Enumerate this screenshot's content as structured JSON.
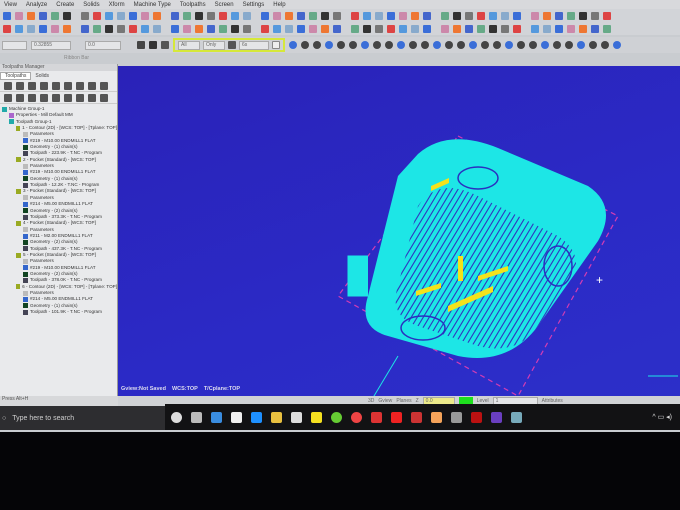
{
  "menu": [
    "View",
    "Analyze",
    "Create",
    "Solids",
    "Xform",
    "Machine Type",
    "Toolpaths",
    "Screen",
    "Settings",
    "Help"
  ],
  "ribbon": {
    "label": "Ribbon Bar",
    "field1": "0.32855",
    "field2": "0.0",
    "all": "All",
    "only": "Only",
    "mode": "6s"
  },
  "panel": {
    "title": "Toolpaths Manager",
    "tabs": [
      "Toolpaths",
      "Solids"
    ]
  },
  "tree": [
    {
      "lvl": 0,
      "t": "Machine Group-1",
      "k": "group"
    },
    {
      "lvl": 1,
      "t": "Properties - Mill Default MM",
      "k": "prop"
    },
    {
      "lvl": 1,
      "t": "Toolpath Group-1",
      "k": "group"
    },
    {
      "lvl": 2,
      "t": "1 - Contour (2D) - [WCS: TOP] - [Tplane: TOP]",
      "k": "op"
    },
    {
      "lvl": 3,
      "t": "Parameters",
      "k": "param"
    },
    {
      "lvl": 3,
      "t": "#219 - M10.00 ENDMILL1 FLAT",
      "k": "tool"
    },
    {
      "lvl": 3,
      "t": "Geometry - (1) chain(s)",
      "k": "geo"
    },
    {
      "lvl": 3,
      "t": "Toolpath - 223.9K - T.NC - Program",
      "k": "path"
    },
    {
      "lvl": 2,
      "t": "2 - Pocket (Standard) - [WCS: TOP]",
      "k": "op"
    },
    {
      "lvl": 3,
      "t": "Parameters",
      "k": "param"
    },
    {
      "lvl": 3,
      "t": "#219 - M10.00 ENDMILL1 FLAT",
      "k": "tool"
    },
    {
      "lvl": 3,
      "t": "Geometry - (1) chain(s)",
      "k": "geo"
    },
    {
      "lvl": 3,
      "t": "Toolpath - 12.2K - T.NC - Program",
      "k": "path"
    },
    {
      "lvl": 2,
      "t": "3 - Pocket (Standard) - [WCS: TOP]",
      "k": "op"
    },
    {
      "lvl": 3,
      "t": "Parameters",
      "k": "param"
    },
    {
      "lvl": 3,
      "t": "#214 - M5.00 ENDMILL1 FLAT",
      "k": "tool"
    },
    {
      "lvl": 3,
      "t": "Geometry - (2) chain(s)",
      "k": "geo"
    },
    {
      "lvl": 3,
      "t": "Toolpath - 373.3K - T.NC - Program",
      "k": "path"
    },
    {
      "lvl": 2,
      "t": "4 - Pocket (Standard) - [WCS: TOP]",
      "k": "op"
    },
    {
      "lvl": 3,
      "t": "Parameters",
      "k": "param"
    },
    {
      "lvl": 3,
      "t": "#211 - M2.00 ENDMILL1 FLAT",
      "k": "tool"
    },
    {
      "lvl": 3,
      "t": "Geometry - (2) chain(s)",
      "k": "geo"
    },
    {
      "lvl": 3,
      "t": "Toolpath - 437.3K - T.NC - Program",
      "k": "path"
    },
    {
      "lvl": 2,
      "t": "5 - Pocket (Standard) - [WCS: TOP]",
      "k": "op"
    },
    {
      "lvl": 3,
      "t": "Parameters",
      "k": "param"
    },
    {
      "lvl": 3,
      "t": "#219 - M10.00 ENDMILL1 FLAT",
      "k": "tool"
    },
    {
      "lvl": 3,
      "t": "Geometry - (2) chain(s)",
      "k": "geo"
    },
    {
      "lvl": 3,
      "t": "Toolpath - 378.0K - T.NC - Program",
      "k": "path"
    },
    {
      "lvl": 2,
      "t": "6 - Contour (2D) - [WCS: TOP] - [Tplane: TOP]",
      "k": "op"
    },
    {
      "lvl": 3,
      "t": "Parameters",
      "k": "param"
    },
    {
      "lvl": 3,
      "t": "#214 - M5.00 ENDMILL1 FLAT",
      "k": "tool"
    },
    {
      "lvl": 3,
      "t": "Geometry - (1) chain(s)",
      "k": "geo"
    },
    {
      "lvl": 3,
      "t": "Toolpath - 101.9K - T.NC - Program",
      "k": "path"
    }
  ],
  "viewport": {
    "gview": "Gview:Not Saved",
    "wcs": "WCS:TOP",
    "tplane": "T/Cplane:TOP"
  },
  "statusbar": {
    "mode": "3D",
    "gview": "Gview",
    "planes": "Planes",
    "z_label": "Z",
    "z": "0.0",
    "level_label": "Level",
    "level": "1",
    "attributes": "Attributes"
  },
  "leftstub": "Press Alt+H",
  "search": {
    "placeholder": "Type here to search"
  },
  "taskbar": {
    "apps": [
      "cortana",
      "task-view",
      "people",
      "store",
      "edge",
      "file-explorer",
      "mail",
      "sticky-notes",
      "utorrent",
      "chrome",
      "app-red",
      "acrobat",
      "app-red2",
      "app-orange",
      "mastercam",
      "app-dark",
      "app-purple",
      "app-network"
    ]
  },
  "colors": {
    "viewport": "#2b28c2",
    "part": "#1de6e6",
    "feature": "#f4e21c",
    "boundary": "#d23cb4"
  }
}
